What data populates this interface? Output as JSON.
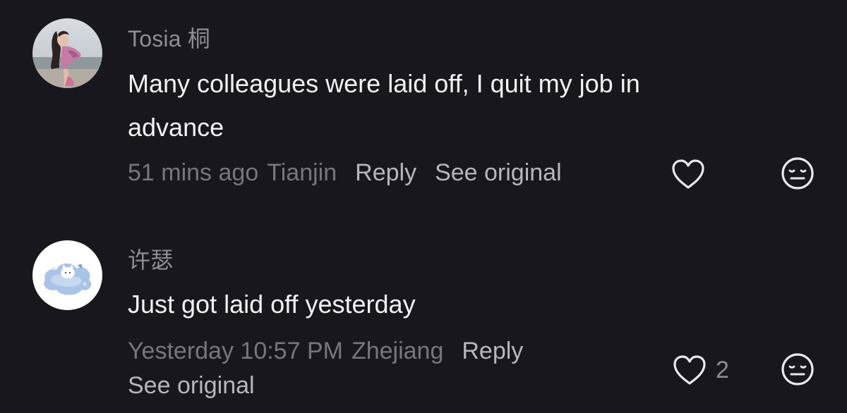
{
  "comments": [
    {
      "username": "Tosia 桐",
      "text": "Many colleagues were laid off, I quit my job in advance",
      "time": "51 mins ago",
      "location": "Tianjin",
      "reply_label": "Reply",
      "see_original_label": "See original",
      "like_count": "",
      "avatar": "photo-avatar"
    },
    {
      "username": "许瑟",
      "text": "Just got laid off yesterday",
      "time": "Yesterday 10:57 PM",
      "location": "Zhejiang",
      "reply_label": "Reply",
      "see_original_label": "See original",
      "like_count": "2",
      "avatar": "illustrated-cat-avatar"
    }
  ],
  "icons": {
    "like": "heart-outline-icon",
    "dislike": "neutral-face-icon"
  },
  "colors": {
    "background": "#18171d",
    "text_primary": "#f2f2f4",
    "text_secondary": "#8e8d93",
    "text_meta": "#77767c",
    "action": "#b7b6bc"
  }
}
